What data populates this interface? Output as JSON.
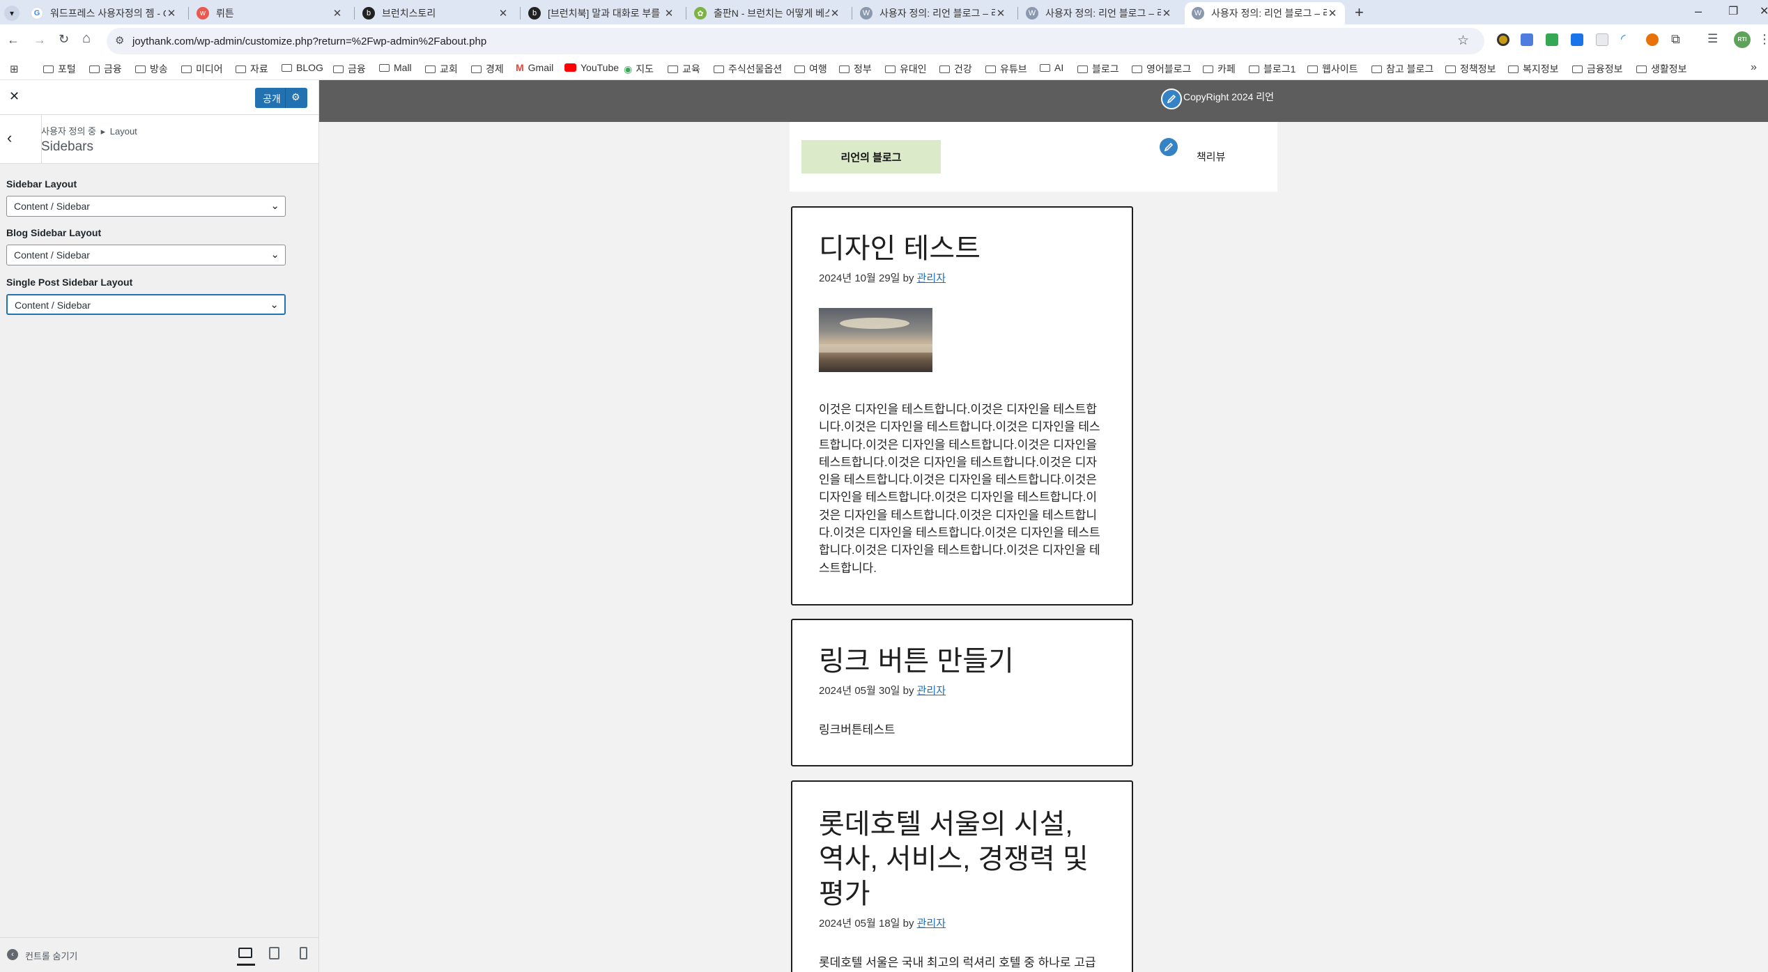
{
  "browser": {
    "tabs": [
      {
        "title": "워드프레스 사용자정의 젬 - G",
        "icon": "google-icon",
        "active": false
      },
      {
        "title": "뤼튼",
        "icon": "wrtn-icon",
        "active": false
      },
      {
        "title": "브런치스토리",
        "icon": "brunch-icon",
        "active": false
      },
      {
        "title": "[브런치북] 말과 대화로 부를 일",
        "icon": "brunch-icon",
        "active": false
      },
      {
        "title": "출판N - 브런치는 어떻게 베스",
        "icon": "leaf-icon",
        "active": false
      },
      {
        "title": "사용자 정의: 리언 블로그 – 리",
        "icon": "wordpress-icon",
        "active": false
      },
      {
        "title": "사용자 정의: 리언 블로그 – 리",
        "icon": "wordpress-icon",
        "active": false
      },
      {
        "title": "사용자 정의: 리언 블로그 – 리",
        "icon": "wordpress-icon",
        "active": true
      }
    ],
    "url": "joythank.com/wp-admin/customize.php?return=%2Fwp-admin%2Fabout.php",
    "bookmarks": [
      "포털",
      "금융",
      "방송",
      "미디어",
      "자료",
      "BLOG",
      "금융",
      "Mall",
      "교회",
      "경제",
      "Gmail",
      "YouTube",
      "지도",
      "교육",
      "주식선물옵션",
      "여행",
      "정부",
      "유대인",
      "건강",
      "유튜브",
      "AI",
      "블로그",
      "영어블로그",
      "카페",
      "블로그1",
      "웹사이트",
      "참고 블로그",
      "정책정보",
      "복지정보",
      "금융정보",
      "생활정보"
    ],
    "avatar_text": "RTI"
  },
  "customizer": {
    "publish_label": "공개",
    "breadcrumb_root": "사용자 정의 중",
    "breadcrumb_sep": "▸",
    "breadcrumb_parent": "Layout",
    "section_title": "Sidebars",
    "fields": [
      {
        "label": "Sidebar Layout",
        "value": "Content / Sidebar"
      },
      {
        "label": "Blog Sidebar Layout",
        "value": "Content / Sidebar"
      },
      {
        "label": "Single Post Sidebar Layout",
        "value": "Content / Sidebar"
      }
    ],
    "hide_controls_label": "컨트롤 숨기기"
  },
  "preview": {
    "copyright": "CopyRight 2024 리언",
    "site_title": "리언의 블로그",
    "menu_item": "책리뷰",
    "posts": [
      {
        "title": "디자인 테스트",
        "date": "2024년 10월 29일",
        "by": "by",
        "author": "관리자",
        "excerpt": "이것은 디자인을 테스트합니다.이것은 디자인을 테스트합니다.이것은 디자인을 테스트합니다.이것은 디자인을 테스트합니다.이것은 디자인을 테스트합니다.이것은 디자인을 테스트합니다.이것은 디자인을 테스트합니다.이것은 디자인을 테스트합니다.이것은 디자인을 테스트합니다.이것은 디자인을 테스트합니다.이것은 디자인을 테스트합니다.이것은 디자인을 테스트합니다.이것은 디자인을 테스트합니다.이것은 디자인을 테스트합니다.이것은 디자인을 테스트합니다.이것은 디자인을 테스트합니다.이것은 디자인을 테스트합니다."
      },
      {
        "title": "링크 버튼 만들기",
        "date": "2024년 05월 30일",
        "by": "by",
        "author": "관리자",
        "excerpt": "링크버튼테스트"
      },
      {
        "title": "롯데호텔 서울의 시설, 역사, 서비스, 경쟁력 및 평가",
        "date": "2024년 05월 18일",
        "by": "by",
        "author": "관리자",
        "excerpt": "롯데호텔 서울은 국내 최고의 럭셔리 호텔 중 하나로 고급스러운 객실과 편의 시설, 다양한 부대시설을 갖"
      }
    ]
  },
  "colors": {
    "wp_blue": "#2271b1",
    "topbar": "#5d5d5d",
    "logo_bg": "#dbeac8",
    "link": "#1a6fc4"
  }
}
